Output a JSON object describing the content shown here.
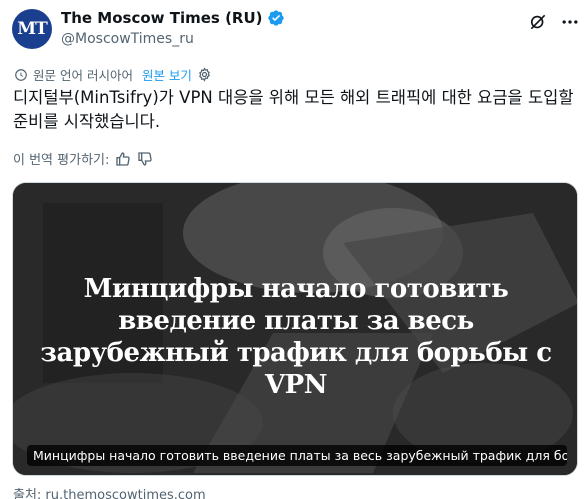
{
  "author": {
    "avatar_text": "MT",
    "display_name": "The Moscow Times (RU)",
    "handle": "@MoscowTimes_ru"
  },
  "translate": {
    "translated_from": "원문 언어 러시아어",
    "show_original": "원본 보기"
  },
  "tweet": {
    "text": "디지털부(MinTsifry)가 VPN 대응을 위해 모든 해외 트래픽에 대한 요금을 도입할 준비를 시작했습니다."
  },
  "rating": {
    "label": "이 번역 평가하기:"
  },
  "card": {
    "headline": "Минцифры начало готовить введение платы за весь зарубежный трафик для борьбы с VPN",
    "caption": "Минцифры начало готовить введение платы за весь зарубежный трафик для борьбы ...",
    "source": "출처: ru.themoscowtimes.com"
  },
  "colors": {
    "accent": "#1d9bf0",
    "avatar_bg": "#1b3f8f",
    "muted": "#536471"
  },
  "icons": [
    "verified-badge-icon",
    "grok-icon",
    "more-icon",
    "translate-icon",
    "gear-icon",
    "thumbs-up-icon",
    "thumbs-down-icon"
  ]
}
